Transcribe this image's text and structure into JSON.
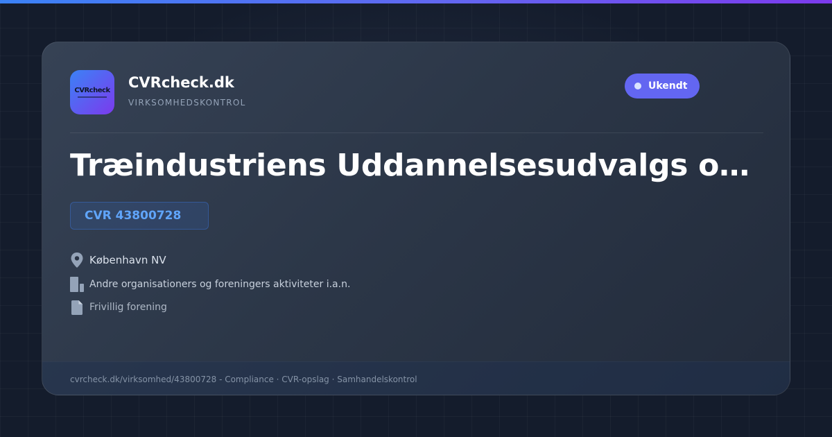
{
  "brand": {
    "name": "CVRcheck.dk",
    "tagline": "VIRKSOMHEDSKONTROL",
    "logo_text": "CVRcheck"
  },
  "status": {
    "label": "Ukendt"
  },
  "company": {
    "name": "Træindustriens Uddannelsesudvalgs offe...",
    "cvr": "CVR 43800728",
    "location": "København NV",
    "industry": "Andre organisationers og foreningers aktiviteter i.a.n.",
    "company_type": "Frivillig forening"
  },
  "footer": {
    "text": "cvrcheck.dk/virksomhed/43800728 - Compliance · CVR-opslag · Samhandelskontrol"
  },
  "icons": {
    "location": "map-pin-icon",
    "industry": "building-icon",
    "company_type": "document-icon"
  },
  "colors": {
    "accent_start": "#3b82f6",
    "accent_end": "#7c3aed",
    "status_badge": "#6366f1",
    "cvr_text": "#60a5fa"
  }
}
